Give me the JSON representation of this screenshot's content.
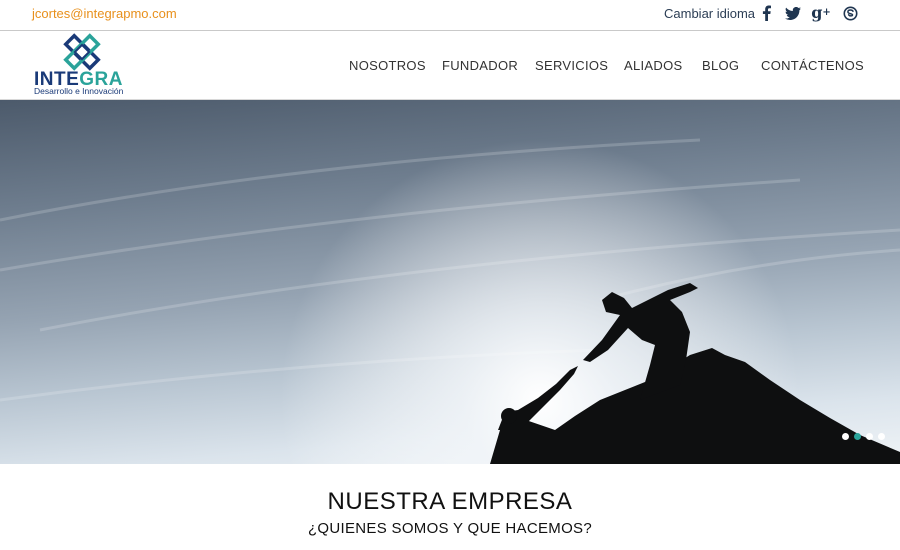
{
  "topbar": {
    "email": "jcortes@integrapmo.com",
    "language_label": "Cambiar idioma",
    "social_icons": [
      "facebook-icon",
      "twitter-icon",
      "google-plus-icon",
      "skype-icon"
    ]
  },
  "logo": {
    "brand_part1": "INTE",
    "brand_part2": "GRA",
    "tagline": "Desarrollo e Innovación"
  },
  "nav": {
    "items": [
      {
        "label": "NOSOTROS"
      },
      {
        "label": "FUNDADOR"
      },
      {
        "label": "SERVICIOS"
      },
      {
        "label": "ALIADOS"
      },
      {
        "label": "BLOG"
      },
      {
        "label": "CONTÁCTENOS"
      }
    ]
  },
  "hero": {
    "slide_count": 4,
    "active_slide": 2
  },
  "section": {
    "title": "NUESTRA EMPRESA",
    "subtitle": "¿QUIENES SOMOS Y QUE HACEMOS?"
  },
  "colors": {
    "accent_orange": "#e8901c",
    "brand_blue": "#1a3a78",
    "brand_teal": "#2aa39a"
  }
}
